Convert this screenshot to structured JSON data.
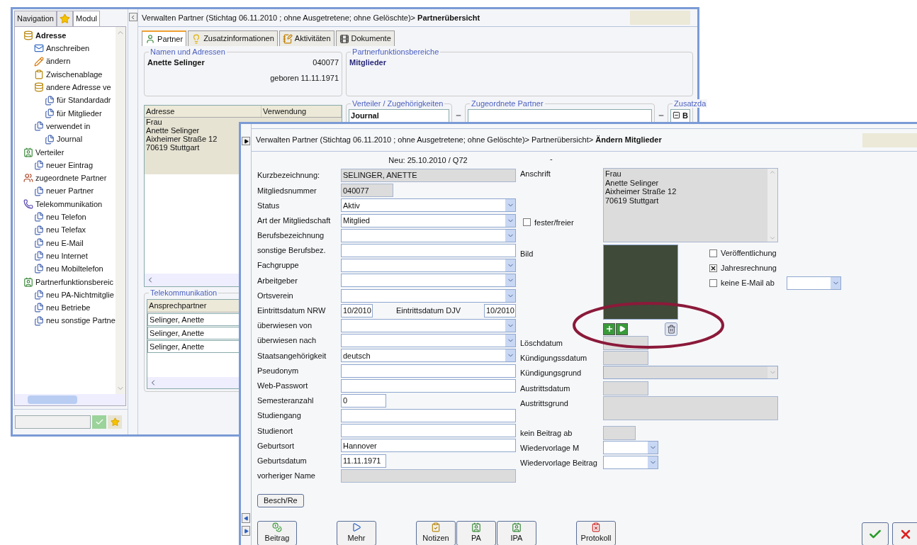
{
  "back_window": {
    "nav_tabs": [
      {
        "kind": "text",
        "label": "Navigation",
        "selected": false
      },
      {
        "kind": "star",
        "selected": false
      },
      {
        "kind": "text",
        "label": "Modul",
        "selected": true
      }
    ],
    "tree": [
      {
        "label": "Adresse",
        "kind": "database",
        "bold": true,
        "children": [
          {
            "label": "Anschreiben",
            "kind": "letter"
          },
          {
            "label": "ändern",
            "kind": "pencil"
          },
          {
            "label": "Zwischenablage",
            "kind": "clipboard"
          },
          {
            "label": "andere Adresse ve",
            "kind": "database",
            "children": [
              {
                "label": "für Standardadr",
                "kind": "page"
              },
              {
                "label": "für Mitglieder",
                "kind": "page"
              }
            ]
          },
          {
            "label": "verwendet in",
            "kind": "page",
            "children": [
              {
                "label": "Journal",
                "kind": "page"
              }
            ]
          }
        ]
      },
      {
        "label": "Verteiler",
        "kind": "card",
        "bold": false,
        "children": [
          {
            "label": "neuer Eintrag",
            "kind": "page"
          }
        ]
      },
      {
        "label": "zugeordnete Partner",
        "kind": "people",
        "bold": false,
        "children": [
          {
            "label": "neuer Partner",
            "kind": "page"
          }
        ]
      },
      {
        "label": "Telekommunikation",
        "kind": "phone",
        "bold": false,
        "children": [
          {
            "label": "neu Telefon",
            "kind": "page"
          },
          {
            "label": "neu Telefax",
            "kind": "page"
          },
          {
            "label": "neu E-Mail",
            "kind": "page"
          },
          {
            "label": "neu Internet",
            "kind": "page"
          },
          {
            "label": "neu Mobiltelefon",
            "kind": "page"
          }
        ]
      },
      {
        "label": "Partnerfunktionsbereic",
        "kind": "card",
        "bold": false,
        "children": [
          {
            "label": "neu PA-Nichtmitglie",
            "kind": "page"
          },
          {
            "label": "neu Betriebe",
            "kind": "page"
          },
          {
            "label": "neu sonstige Partne",
            "kind": "page"
          }
        ]
      }
    ],
    "title": "Verwalten Partner (Stichtag 06.11.2010 ; ohne Ausgetretene; ohne Gelöschte)> **Partnerübersicht**",
    "tabs": [
      {
        "label": "Partner",
        "kind": "person",
        "selected": true
      },
      {
        "label": "Zusatzinformationen",
        "kind": "bulb",
        "selected": false
      },
      {
        "label": "Aktivitäten",
        "kind": "notepad",
        "selected": false
      },
      {
        "label": "Dokumente",
        "kind": "film",
        "selected": false
      }
    ],
    "names": {
      "legend": "Namen und Adressen",
      "name": "Anette Selinger",
      "number": "040077",
      "born": "geboren 11.11.1971"
    },
    "functions": {
      "legend": "Partnerfunktionsbereiche",
      "value": "Mitglieder"
    },
    "address_table": {
      "columns": [
        "Adresse",
        "Verwendung"
      ],
      "lines": [
        "Frau",
        "Anette Selinger",
        "Aixheimer Straße 12",
        "70619 Stuttgart"
      ]
    },
    "sub_groups": [
      {
        "legend": "Verteiler / Zugehörigkeiten",
        "value": "Journal",
        "expander": false
      },
      {
        "legend": "Zugeordnete Partner",
        "expander": false
      },
      {
        "legend": "Zusatzda",
        "value": "B",
        "expander": true
      }
    ],
    "telecom": {
      "legend": "Telekommunikation",
      "column": "Ansprechpartner",
      "rows": [
        "Selinger, Anette",
        "Selinger, Anette",
        "Selinger, Anette"
      ]
    }
  },
  "front_window": {
    "title": "Verwalten Partner (Stichtag 06.11.2010 ; ohne Ausgetretene; ohne Gelöschte)> Partnerübersicht> **Ändern Mitglieder**",
    "created": "Neu: 25.10.2010 / Q72",
    "mark": "-",
    "fields": [
      {
        "label": "Kurzbezeichnung:",
        "kind": "readonly",
        "value": "SELINGER, ANETTE",
        "short": false
      },
      {
        "label": "Mitgliedsnummer",
        "kind": "readonly",
        "value": "040077",
        "short": true
      },
      {
        "label": "Status",
        "kind": "select",
        "value": "Aktiv",
        "short": false
      },
      {
        "label": "Art der Mitgliedschaft",
        "kind": "select",
        "value": "Mitglied",
        "short": false
      },
      {
        "label": "Berufsbezeichnung",
        "kind": "select",
        "short": false
      },
      {
        "label": "sonstige Berufsbez.",
        "kind": "text",
        "short": false
      },
      {
        "label": "Fachgruppe",
        "kind": "select",
        "short": false
      },
      {
        "label": "Arbeitgeber",
        "kind": "select",
        "short": false
      },
      {
        "label": "Ortsverein",
        "kind": "select",
        "short": false
      },
      {
        "label": "Eintrittsdatum NRW",
        "kind": "pair",
        "value": "10/2010",
        "label2": "Eintrittsdatum DJV",
        "value2": "10/2010"
      },
      {
        "label": "überwiesen von",
        "kind": "select",
        "short": false
      },
      {
        "label": "überwiesen nach",
        "kind": "select",
        "short": false
      },
      {
        "label": "Staatsangehörigkeit",
        "kind": "select",
        "value": "deutsch",
        "short": false
      },
      {
        "label": "Pseudonym",
        "kind": "text",
        "short": false
      },
      {
        "label": "Web-Passwort",
        "kind": "text",
        "short": false
      },
      {
        "label": "Semesteranzahl",
        "kind": "text",
        "value": "0",
        "short": true
      },
      {
        "label": "Studiengang",
        "kind": "text",
        "short": false
      },
      {
        "label": "Studienort",
        "kind": "text",
        "short": false
      },
      {
        "label": "Geburtsort",
        "kind": "text",
        "value": "Hannover",
        "short": false
      },
      {
        "label": "Geburtsdatum",
        "kind": "text",
        "value": "11.11.1971",
        "short": true
      },
      {
        "label": "vorheriger Name",
        "kind": "readonly",
        "short": false
      }
    ],
    "address": {
      "label": "Anschrift",
      "lines": [
        "Frau",
        "Anette Selinger",
        "Aixheimer Straße 12",
        "70619 Stuttgart"
      ]
    },
    "fester": {
      "label": "fester/freier",
      "checked": false
    },
    "picture": {
      "label": "Bild"
    },
    "options": [
      {
        "label": "Veröffentlichung",
        "checked": false,
        "kind": "plain"
      },
      {
        "label": "Jahresrechnung",
        "checked": true,
        "kind": "plain"
      },
      {
        "label": "keine E-Mail ab",
        "checked": false,
        "kind": "with-select"
      }
    ],
    "right_fields": [
      {
        "label": "Löschdatum",
        "kind": "readonly-short"
      },
      {
        "label": "Kündigungssdatum",
        "kind": "readonly-short"
      },
      {
        "label": "Kündigungsgrund",
        "kind": "readonly-select"
      },
      {
        "label": "Austrittsdatum",
        "kind": "readonly-short"
      },
      {
        "label": "Austrittsgrund",
        "kind": "readonly-tall"
      },
      {
        "label": "kein Beitrag ab",
        "kind": "readonly-tiny"
      },
      {
        "label": "Wiedervorlage M",
        "kind": "select"
      },
      {
        "label": "Wiedervorlage Beitrag",
        "kind": "select"
      }
    ],
    "extra_button": "Besch/Re",
    "toolbar": [
      [
        {
          "label": "Beitrag",
          "kind": "money"
        }
      ],
      [
        {
          "label": "Mehr",
          "kind": "play"
        }
      ],
      [
        {
          "label": "Notizen",
          "kind": "notes"
        },
        {
          "label": "PA",
          "kind": "card"
        },
        {
          "label": "IPA",
          "kind": "card"
        }
      ],
      [
        {
          "label": "Protokoll",
          "kind": "protocol"
        }
      ]
    ],
    "confirm": [
      {
        "kind": "ok"
      },
      {
        "kind": "cancel"
      }
    ]
  }
}
